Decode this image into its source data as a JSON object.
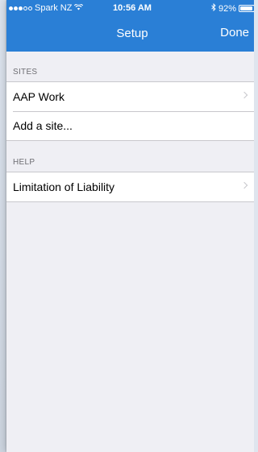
{
  "statusbar": {
    "carrier": "Spark NZ",
    "time": "10:56 AM",
    "battery_text": "92%",
    "battery_level": 0.92,
    "signal_bars_filled": 3,
    "signal_bars_total": 5
  },
  "navbar": {
    "title": "Setup",
    "done_label": "Done",
    "background": "#2a7fd6"
  },
  "sections": {
    "sites": {
      "header": "SITES",
      "items": [
        {
          "label": "AAP Work",
          "chevron": true
        },
        {
          "label": "Add a site...",
          "chevron": false
        }
      ]
    },
    "help": {
      "header": "HELP",
      "items": [
        {
          "label": "Limitation of Liability",
          "chevron": true
        }
      ]
    }
  },
  "icons": {
    "wifi": "wifi-icon",
    "bluetooth": "bluetooth-icon",
    "battery": "battery-icon",
    "chevron": "chevron-right-icon"
  }
}
